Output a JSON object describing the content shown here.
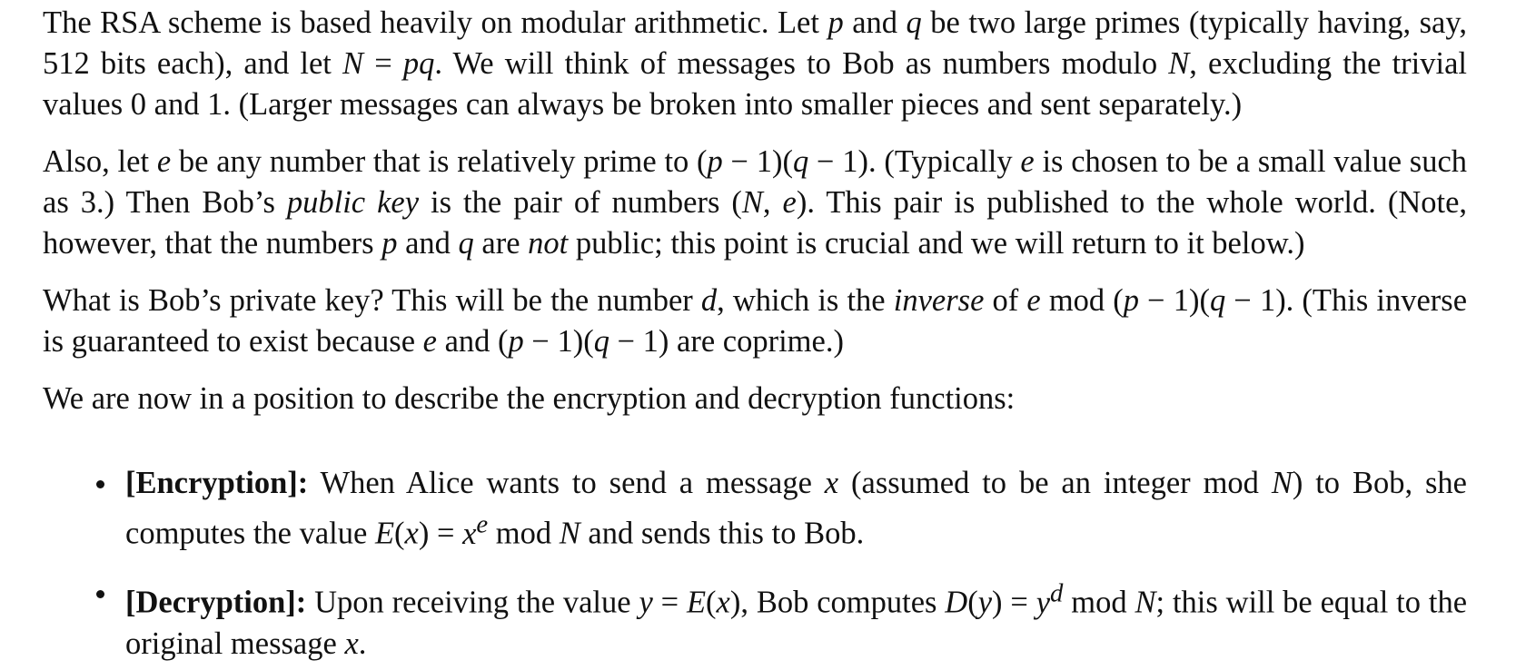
{
  "paragraphs": [
    {
      "html": "The RSA scheme is based heavily on modular arithmetic. Let <i>p</i> and <i>q</i> be two large primes (typically having, say, 512 bits each), and let <i>N</i> = <i>pq</i>. We will think of messages to Bob as numbers modulo <i>N</i>, excluding the trivial values 0 and 1. (Larger messages can always be broken into smaller pieces and sent separately.)"
    },
    {
      "html": "Also, let <i>e</i> be any number that is relatively prime to (<i>p</i> − 1)(<i>q</i> − 1). (Typically <i>e</i> is chosen to be a small value such as 3.) Then Bob’s <i>public key</i> is the pair of numbers (<i>N</i>, <i>e</i>). This pair is published to the whole world. (Note, however, that the numbers <i>p</i> and <i>q</i> are <i>not</i> public; this point is crucial and we will return to it below.)"
    },
    {
      "html": "What is Bob’s private key? This will be the number <i>d</i>, which is the <i>inverse</i> of <i>e</i> mod (<i>p</i> − 1)(<i>q</i> − 1). (This inverse is guaranteed to exist because <i>e</i> and (<i>p</i> − 1)(<i>q</i> − 1) are coprime.)"
    },
    {
      "html": "We are now in a position to describe the encryption and decryption functions:"
    }
  ],
  "bullets": [
    {
      "label": "[Encryption]:",
      "html": "When Alice wants to send a message <i>x</i> (assumed to be an integer mod <i>N</i>) to Bob, she computes the value <i>E</i>(<i>x</i>) = <i>x<sup>e</sup></i> mod <i>N</i> and sends this to Bob."
    },
    {
      "label": "[Decryption]:",
      "html": "Upon receiving the value <i>y</i> = <i>E</i>(<i>x</i>), Bob computes <i>D</i>(<i>y</i>) = <i>y<sup>d</sup></i> mod <i>N</i>; this will be equal to the original message <i>x</i>."
    }
  ]
}
